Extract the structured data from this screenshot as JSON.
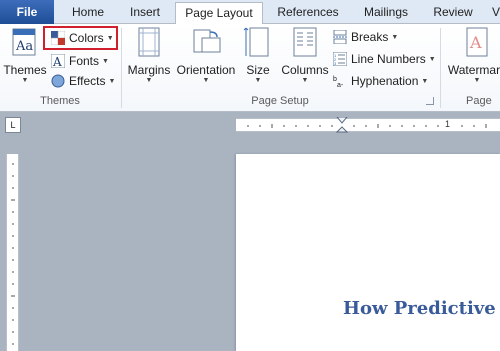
{
  "tabs": {
    "file": "File",
    "home": "Home",
    "insert": "Insert",
    "page_layout": "Page Layout",
    "references": "References",
    "mailings": "Mailings",
    "review": "Review",
    "more": "V"
  },
  "themes_group": {
    "themes_label": "Themes",
    "colors_label": "Colors",
    "fonts_label": "Fonts",
    "effects_label": "Effects",
    "group_label": "Themes"
  },
  "page_setup_group": {
    "margins_label": "Margins",
    "orientation_label": "Orientation",
    "size_label": "Size",
    "columns_label": "Columns",
    "breaks_label": "Breaks",
    "line_numbers_label": "Line Numbers",
    "hyphenation_label": "Hyphenation",
    "group_label": "Page Setup"
  },
  "page_background_group": {
    "watermark_label": "Watermark",
    "group_label": "Page"
  },
  "ruler": {
    "tab_selector_glyph": "L",
    "mark_1": "1"
  },
  "document": {
    "heading": "How Predictive A"
  },
  "colors": {
    "file_tab": "#2b579a",
    "highlight": "#d0202e",
    "heading": "#3a5b9a"
  }
}
